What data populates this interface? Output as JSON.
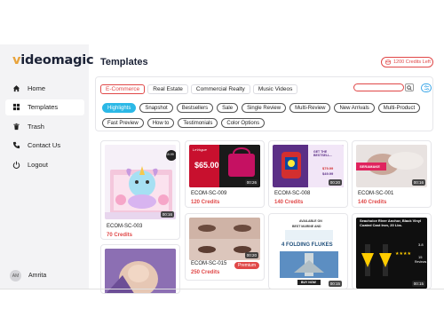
{
  "app": {
    "logo_v": "v",
    "logo_rest": "ideomagic"
  },
  "sidebar": {
    "items": [
      {
        "label": "Home",
        "icon": "home-icon"
      },
      {
        "label": "Templates",
        "icon": "grid-icon"
      },
      {
        "label": "Trash",
        "icon": "trash-icon"
      },
      {
        "label": "Contact Us",
        "icon": "phone-icon"
      },
      {
        "label": "Logout",
        "icon": "power-icon"
      }
    ],
    "active": "Templates",
    "user": {
      "initials": "AM",
      "name": "Amrita"
    }
  },
  "header": {
    "title": "Templates",
    "credits_label": "1200 Credits Left"
  },
  "categories": [
    "E-Commerce",
    "Real Estate",
    "Commercial Realty",
    "Music Videos"
  ],
  "active_category": "E-Commerce",
  "search": {
    "placeholder": "",
    "icon": "search-icon"
  },
  "filters": {
    "row1": [
      "Highlights",
      "Snapshot",
      "Bestsellers",
      "Sale",
      "Single Review",
      "Multi-Review",
      "New Arrivals",
      "Multi-Product"
    ],
    "row2": [
      "Fast Preview",
      "How to",
      "Testimonials",
      "Color Options"
    ],
    "active": "Highlights"
  },
  "cards": [
    {
      "id": "ECOM-SC-003",
      "credits": "70 Credits",
      "duration": "00:16",
      "badge": "$19.99"
    },
    {
      "id": "ECOM-SC-009",
      "credits": "120 Credits",
      "duration": "00:26",
      "price": "$65.00",
      "brand": "LeVogue"
    },
    {
      "id": "ECOM-SC-008",
      "credits": "140 Credits",
      "duration": "00:20",
      "headline": "GET THE BESTSELL...",
      "price1": "$79.99",
      "price2": "$49.99"
    },
    {
      "id": "ECOM-SC-001",
      "credits": "140 Credits",
      "duration": "00:16",
      "tag": "SERAMAKE"
    },
    {
      "id": "ECOM-SC-015",
      "credits": "250 Credits",
      "duration": "00:20",
      "premium": "Premium"
    },
    {
      "id": "",
      "credits": "",
      "duration": "00:15",
      "top": "AVAILABLE ON",
      "title": "BEST MARINE AND",
      "heading": "4 FOLDING FLUKES",
      "cta": "BUY NOW"
    },
    {
      "id": "",
      "credits": "",
      "duration": "00:15",
      "headline": "Seachoice River Anchor, Black Vinyl Coated Cast Iron, 20 Lbs.",
      "rating": "3.8",
      "reviews_num": "15",
      "reviews_label": "Reviews"
    }
  ],
  "colors": {
    "accent": "#e04848",
    "highlight": "#2bb8e6",
    "sidebar_bg": "#f3f3f5",
    "brand_gold": "#e8a33c"
  }
}
